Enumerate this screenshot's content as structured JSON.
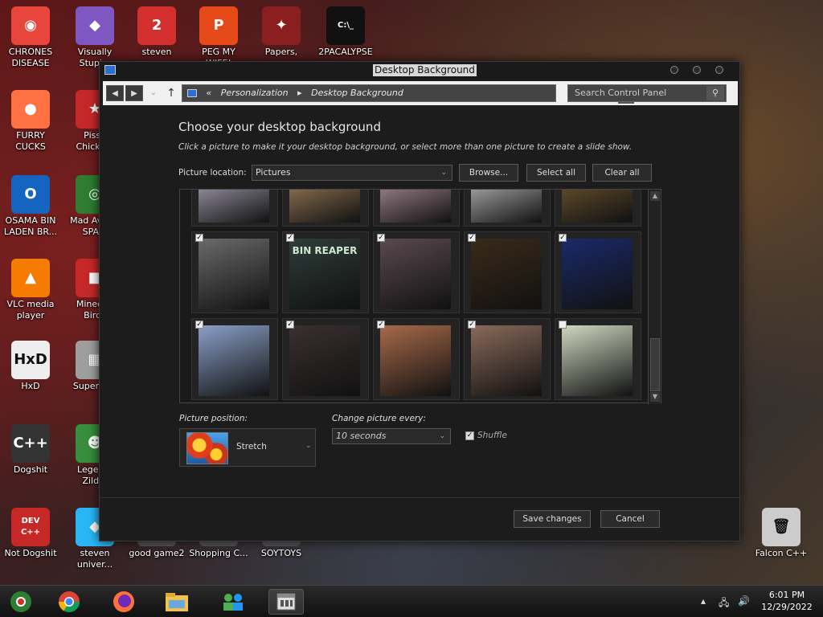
{
  "desktop": {
    "icons": [
      {
        "label": "CHRONES DISEASE",
        "glyph": "◉",
        "color": "#e8453c"
      },
      {
        "label": "Visually Stupi...",
        "glyph": "◆",
        "color": "#7e57c2"
      },
      {
        "label": "steven",
        "glyph": "2",
        "color": "#d32f2f"
      },
      {
        "label": "PEG MY WIFE!",
        "glyph": "P",
        "color": "#e64a19"
      },
      {
        "label": "Papers,",
        "glyph": "✦",
        "color": "#8b1e1e"
      },
      {
        "label": "2PACALYPSE",
        "glyph": "C:\\_",
        "color": "#111111"
      },
      {
        "label": "FURRY CUCKS",
        "glyph": "●",
        "color": "#ff7043"
      },
      {
        "label": "Pissa Chicke...",
        "glyph": "★",
        "color": "#c62828"
      },
      {
        "label": "OSAMA BIN LADEN BR...",
        "glyph": "O",
        "color": "#1565c0"
      },
      {
        "label": "Mad Ave IN SPA...",
        "glyph": "◎",
        "color": "#2e7d32"
      },
      {
        "label": "VLC media player",
        "glyph": "▲",
        "color": "#f57c00"
      },
      {
        "label": "Minecr... Birds",
        "glyph": "■",
        "color": "#c62828"
      },
      {
        "label": "HxD",
        "glyph": "HxD",
        "color": "#eeeeee"
      },
      {
        "label": "Super H...",
        "glyph": "▦",
        "color": "#9e9e9e"
      },
      {
        "label": "Dogshit",
        "glyph": "C++",
        "color": "#333333"
      },
      {
        "label": "Legen... Zild...",
        "glyph": "☻",
        "color": "#388e3c"
      },
      {
        "label": "Not Dogshit",
        "glyph": "DEV C++",
        "color": "#c62828"
      },
      {
        "label": "steven univer...",
        "glyph": "◆",
        "color": "#29b6f6"
      },
      {
        "label": "good game2",
        "glyph": "",
        "color": "#555555"
      },
      {
        "label": "Shopping C...",
        "glyph": "",
        "color": "#555555"
      },
      {
        "label": "SOYTOYS",
        "glyph": "",
        "color": "#555555"
      },
      {
        "label": "Falcon C++",
        "glyph": "🗑",
        "color": "#cccccc"
      }
    ]
  },
  "window": {
    "title": "Desktop Background",
    "address": {
      "prefix": "«",
      "seg1": "Personalization",
      "sep": "▸",
      "seg2": "Desktop Background"
    },
    "search_placeholder": "Search Control Panel",
    "heading": "Choose your desktop background",
    "subheading": "Click a picture to make it your desktop background, or select more than one picture to create a slide show.",
    "picture_location_label": "Picture location:",
    "picture_location_value": "Pictures",
    "browse_label": "Browse...",
    "select_all_label": "Select all",
    "clear_all_label": "Clear all",
    "picture_position_label": "Picture position:",
    "picture_position_value": "Stretch",
    "change_every_label": "Change picture every:",
    "change_every_value": "10 seconds",
    "shuffle_label": "Shuffle",
    "save_label": "Save changes",
    "cancel_label": "Cancel"
  },
  "gallery": {
    "rows": [
      [
        {
          "checked": false,
          "partial": true,
          "tone": "#d8d0e8"
        },
        {
          "checked": false,
          "partial": true,
          "tone": "#c9a070"
        },
        {
          "checked": false,
          "partial": true,
          "tone": "#e0b8c8"
        },
        {
          "checked": false,
          "partial": true,
          "tone": "#eeeeee"
        },
        {
          "checked": false,
          "partial": true,
          "tone": "#8a6a3a"
        }
      ],
      [
        {
          "checked": true,
          "tone": "#6a6a6a"
        },
        {
          "checked": true,
          "tone": "#2f3d3a",
          "caption": "BIN REAPER"
        },
        {
          "checked": true,
          "tone": "#5a4a50"
        },
        {
          "checked": true,
          "tone": "#3a2a1a"
        },
        {
          "checked": true,
          "tone": "#1a2a6a"
        }
      ],
      [
        {
          "checked": true,
          "tone": "#8aa0c8"
        },
        {
          "checked": true,
          "tone": "#3a3030"
        },
        {
          "checked": true,
          "tone": "#a86a4a"
        },
        {
          "checked": true,
          "tone": "#8a6a5a"
        },
        {
          "checked": false,
          "tone": "#cfd8c0"
        }
      ]
    ]
  },
  "taskbar": {
    "time": "6:01 PM",
    "date": "12/29/2022"
  }
}
